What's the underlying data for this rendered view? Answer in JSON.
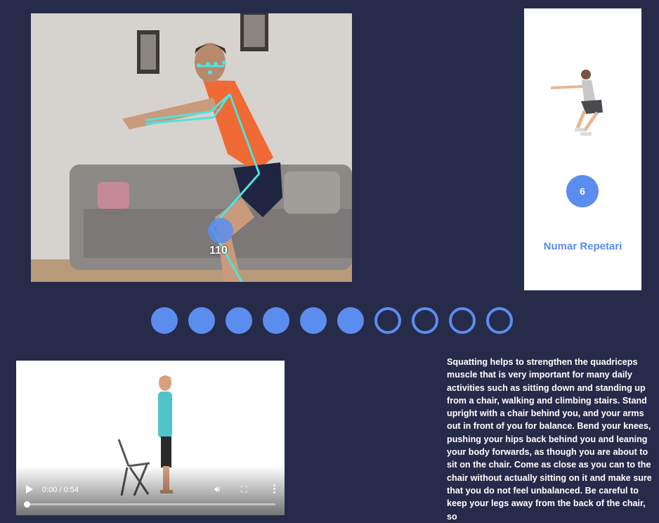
{
  "camera": {
    "angle_value": "110"
  },
  "rep_card": {
    "count": "6",
    "label": "Numar Repetari",
    "image_icon": "squat-figure-icon"
  },
  "progress": {
    "total": 10,
    "completed": 6
  },
  "video": {
    "time": "0:00 / 0:54",
    "play_icon": "play-icon",
    "volume_icon": "volume-icon",
    "fullscreen_icon": "fullscreen-icon",
    "more_icon": "more-options-icon",
    "progress_fraction": 0
  },
  "description": {
    "text": "Squatting helps to strengthen the quadriceps muscle that is very important for many daily activities such as sitting down and standing up from a chair, walking and climbing stairs. Stand upright with a chair behind you, and your arms out in front of you for balance. Bend your knees, pushing your hips back behind you and leaning your body forwards, as though you are about to sit on the chair. Come as close as you can to the chair without actually sitting on it and make sure that you do not feel unbalanced. Be careful to keep your legs away from the back of the chair, so"
  },
  "colors": {
    "background": "#272b4a",
    "accent": "#5b8def",
    "skeleton": "#4fe3e0"
  }
}
